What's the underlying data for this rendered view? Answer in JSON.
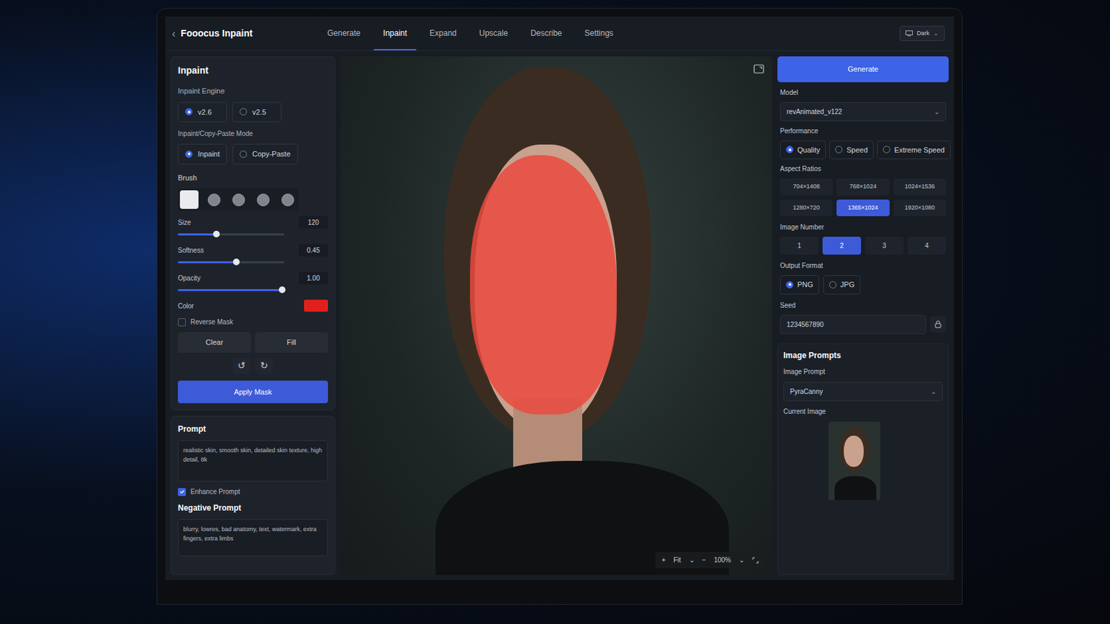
{
  "app": {
    "back": "‹",
    "title": "Fooocus Inpaint",
    "theme": {
      "label": "Dark",
      "arrow": "⌄"
    }
  },
  "tabs": [
    {
      "label": "Generate",
      "selected": false
    },
    {
      "label": "Inpaint",
      "selected": true
    },
    {
      "label": "Expand",
      "selected": false
    },
    {
      "label": "Upscale",
      "selected": false
    },
    {
      "label": "Describe",
      "selected": false
    },
    {
      "label": "Settings",
      "selected": false
    }
  ],
  "left": {
    "title": "Inpaint",
    "engine": {
      "label": "Inpaint Engine",
      "options": [
        {
          "label": "v2.6",
          "selected": true
        },
        {
          "label": "v2.5",
          "selected": false
        }
      ]
    },
    "mode": {
      "label": "Inpaint/Copy-Paste Mode",
      "options": [
        {
          "label": "Inpaint",
          "selected": true
        },
        {
          "label": "Copy-Paste",
          "selected": false
        }
      ]
    },
    "brush": {
      "label": "Brush",
      "shapes": [
        {
          "selected": true
        },
        {
          "selected": false
        },
        {
          "selected": false
        },
        {
          "selected": false
        },
        {
          "selected": false
        }
      ]
    },
    "sliders": [
      {
        "label": "Size",
        "value": "120",
        "level": 0.36
      },
      {
        "label": "Softness",
        "value": "0.45",
        "level": 0.55
      },
      {
        "label": "Opacity",
        "value": "1.00",
        "level": 0.98
      }
    ],
    "color": {
      "label": "Color",
      "color": "#e0201c"
    },
    "reverse_mask": {
      "label": "Reverse Mask",
      "checked": false
    },
    "buttons": [
      "Clear",
      "Fill"
    ],
    "history": [
      "↺",
      "↻"
    ],
    "apply": "Apply Mask"
  },
  "prompt": {
    "label": "Prompt",
    "value": "realistic skin, smooth skin, detailed skin texture, high detail, 8k"
  },
  "enhance": {
    "label": "Enhance Prompt",
    "checked": true
  },
  "negative": {
    "label": "Negative Prompt",
    "value": "blurry, lowres, bad anatomy, text, watermark, extra fingers, extra limbs"
  },
  "canvas": {
    "mask_visible": true,
    "zoom": [
      "+",
      "Fit",
      "⌄",
      "−",
      "100%",
      "⌄"
    ]
  },
  "right": {
    "generate": "Generate",
    "model": {
      "label": "Model",
      "value": "revAnimated_v122",
      "arrow": "⌄"
    },
    "performance": {
      "label": "Performance",
      "options": [
        {
          "label": "Quality",
          "selected": true
        },
        {
          "label": "Speed",
          "selected": false
        },
        {
          "label": "Extreme Speed",
          "selected": false
        }
      ]
    },
    "aspect": {
      "label": "Aspect Ratios",
      "options": [
        {
          "label": "704×1408",
          "selected": false
        },
        {
          "label": "768×1024",
          "selected": false
        },
        {
          "label": "1024×1536",
          "selected": false
        },
        {
          "label": "1280×720",
          "selected": false
        },
        {
          "label": "1365×1024",
          "selected": true
        },
        {
          "label": "1920×1080",
          "selected": false
        }
      ]
    },
    "image_number": {
      "label": "Image Number",
      "options": [
        {
          "label": "1",
          "selected": false
        },
        {
          "label": "2",
          "selected": true
        },
        {
          "label": "3",
          "selected": false
        },
        {
          "label": "4",
          "selected": false
        }
      ]
    },
    "format": {
      "label": "Output Format",
      "options": [
        {
          "label": "PNG",
          "selected": true
        },
        {
          "label": "JPG",
          "selected": false
        }
      ]
    },
    "seed": {
      "label": "Seed",
      "value": "1234567890"
    },
    "image_prompts": {
      "title": "Image Prompts",
      "label": "Image Prompt",
      "value": "PyraCanny",
      "arrow": "⌄",
      "current": "Current Image"
    }
  }
}
